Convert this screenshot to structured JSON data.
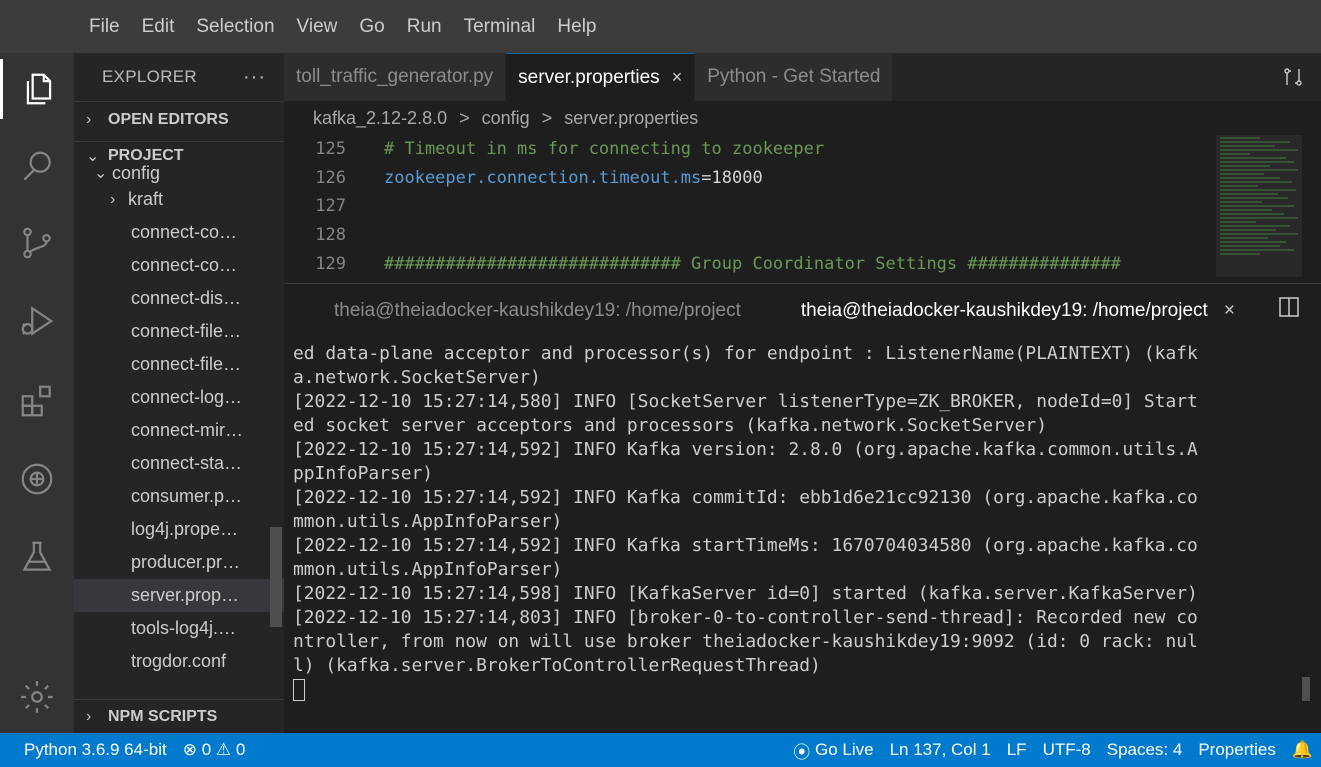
{
  "menu": [
    "File",
    "Edit",
    "Selection",
    "View",
    "Go",
    "Run",
    "Terminal",
    "Help"
  ],
  "activity": [
    "explorer-icon",
    "search-icon",
    "source-control-icon",
    "run-debug-icon",
    "extensions-icon",
    "theia-plugin-icon",
    "testing-icon",
    "settings-gear-icon"
  ],
  "sidebar": {
    "title": "EXPLORER",
    "more": "···",
    "open_editors": "OPEN EDITORS",
    "project": "PROJECT",
    "folder_config": "config",
    "folder_kraft": "kraft",
    "files": [
      "connect-co…",
      "connect-co…",
      "connect-dis…",
      "connect-file…",
      "connect-file…",
      "connect-log…",
      "connect-mir…",
      "connect-sta…",
      "consumer.p…",
      "log4j.prope…",
      "producer.pr…",
      "server.prop…",
      "tools-log4j.…",
      "trogdor.conf"
    ],
    "npm_scripts": "NPM SCRIPTS"
  },
  "tabs": [
    {
      "label": "toll_traffic_generator.py"
    },
    {
      "label": "server.properties",
      "close": "×"
    },
    {
      "label": "Python - Get Started"
    }
  ],
  "breadcrumb": [
    "kafka_2.12-2.8.0",
    "config",
    "server.properties"
  ],
  "breadcrumb_sep": ">",
  "code": {
    "lines": [
      {
        "n": "125",
        "comment": "# Timeout in ms for connecting to zookeeper"
      },
      {
        "n": "126",
        "key": "zookeeper.connection.timeout.ms",
        "val": "=18000"
      },
      {
        "n": "127"
      },
      {
        "n": "128"
      },
      {
        "n": "129",
        "comment": "############################# Group Coordinator Settings ###############"
      }
    ]
  },
  "terminal": {
    "tab1": "theia@theiadocker-kaushikdey19: /home/project",
    "tab2": "theia@theiadocker-kaushikdey19: /home/project",
    "close": "×",
    "lines": [
      "ed data-plane acceptor and processor(s) for endpoint : ListenerName(PLAINTEXT) (kafk",
      "a.network.SocketServer)",
      "[2022-12-10 15:27:14,580] INFO [SocketServer listenerType=ZK_BROKER, nodeId=0] Start",
      "ed socket server acceptors and processors (kafka.network.SocketServer)",
      "[2022-12-10 15:27:14,592] INFO Kafka version: 2.8.0 (org.apache.kafka.common.utils.A",
      "ppInfoParser)",
      "[2022-12-10 15:27:14,592] INFO Kafka commitId: ebb1d6e21cc92130 (org.apache.kafka.co",
      "mmon.utils.AppInfoParser)",
      "[2022-12-10 15:27:14,592] INFO Kafka startTimeMs: 1670704034580 (org.apache.kafka.co",
      "mmon.utils.AppInfoParser)",
      "[2022-12-10 15:27:14,598] INFO [KafkaServer id=0] started (kafka.server.KafkaServer)",
      "[2022-12-10 15:27:14,803] INFO [broker-0-to-controller-send-thread]: Recorded new co",
      "ntroller, from now on will use broker theiadocker-kaushikdey19:9092 (id: 0 rack: nul",
      "l) (kafka.server.BrokerToControllerRequestThread)"
    ]
  },
  "status": {
    "python": "Python 3.6.9 64-bit",
    "errors": "0",
    "warnings": "0",
    "golive": "Go Live",
    "position": "Ln 137, Col 1",
    "eol": "LF",
    "encoding": "UTF-8",
    "spaces": "Spaces: 4",
    "language": "Properties"
  },
  "colors": {
    "accent": "#007acc",
    "comment": "#6a9955",
    "keyword": "#569cd6"
  }
}
